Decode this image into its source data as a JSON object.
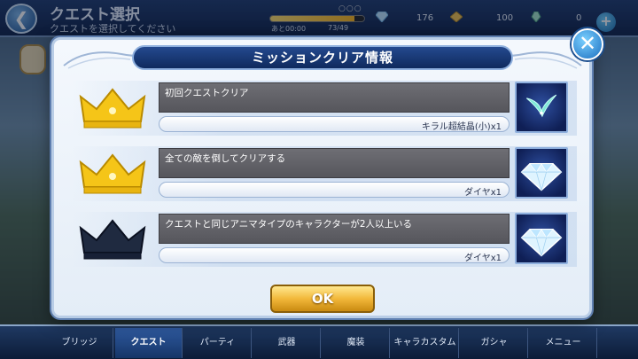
{
  "screen": {
    "title": "クエスト選択",
    "subtitle": "クエストを選択してください",
    "stamina_time": "あと00:00",
    "stamina_value": "73/49",
    "stamina_fill_fraction": 0.9,
    "diamonds": "176",
    "coins": "100",
    "crystals": "0"
  },
  "modal": {
    "title": "ミッションクリア情報",
    "ok_label": "OK",
    "missions": [
      {
        "text": "初回クエストクリア",
        "reward": "キラル超結晶(小)x1",
        "reward_icon": "crystal-shard-icon",
        "cleared": true
      },
      {
        "text": "全ての敵を倒してクリアする",
        "reward": "ダイヤx1",
        "reward_icon": "diamond-icon",
        "cleared": true
      },
      {
        "text": "クエストと同じアニマタイプのキャラクターが2人以上いる",
        "reward": "ダイヤx1",
        "reward_icon": "diamond-icon",
        "cleared": false
      }
    ]
  },
  "nav": [
    "ブリッジ",
    "クエスト",
    "パーティ",
    "武器",
    "魔装",
    "キャラカスタム",
    "ガシャ",
    "メニュー"
  ],
  "colors": {
    "crown_cleared": "#f5c518",
    "crown_uncleared": "#1f2a40",
    "header_bg": "#1a3a78",
    "ok_button": "#f2b83a"
  }
}
